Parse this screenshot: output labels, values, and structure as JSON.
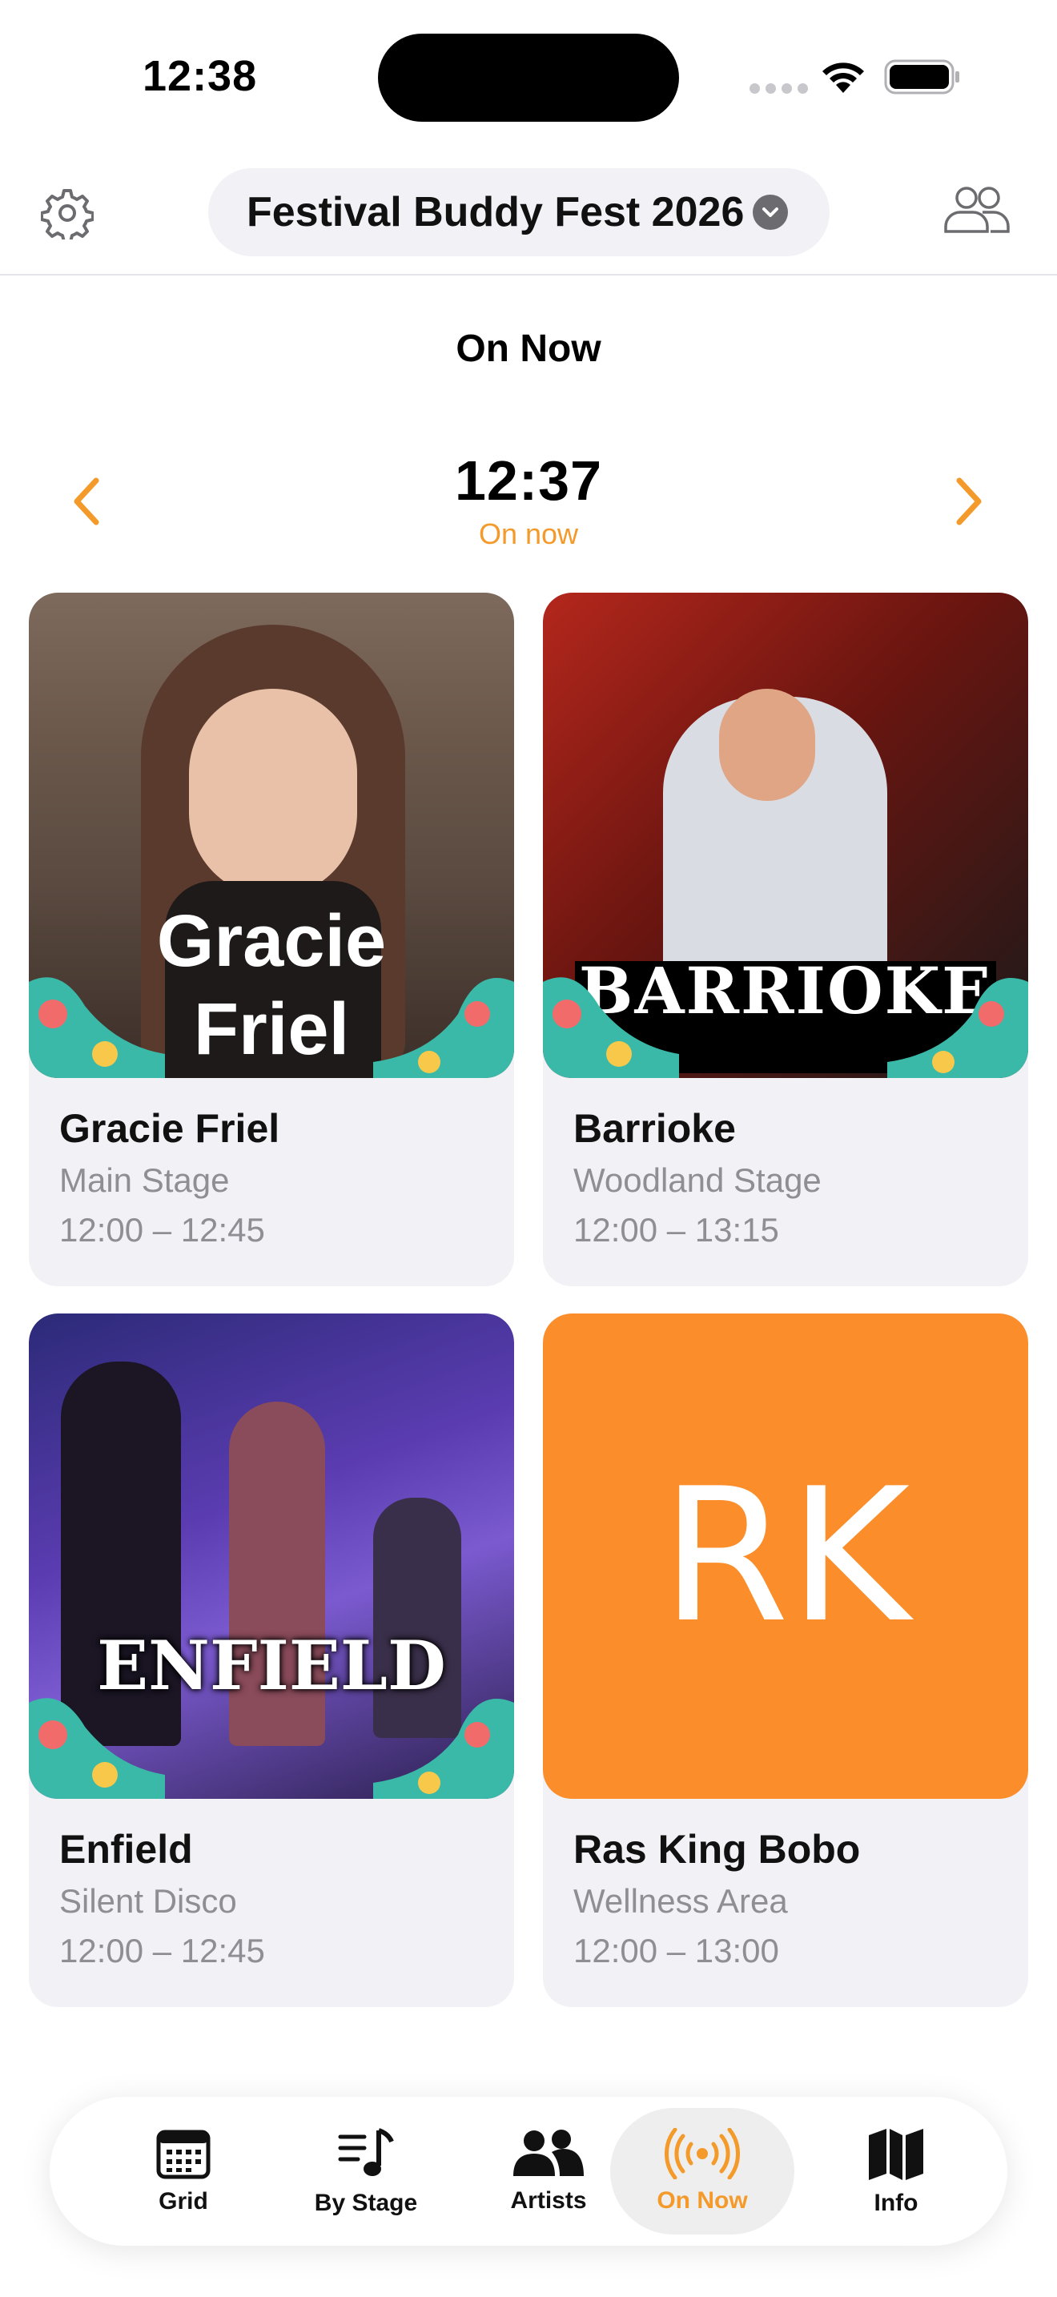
{
  "status_bar": {
    "time": "12:38"
  },
  "header": {
    "festival_name": "Festival Buddy Fest 2026",
    "settings_icon": "gear-icon",
    "friends_icon": "people-icon"
  },
  "page": {
    "title": "On Now"
  },
  "time_nav": {
    "time": "12:37",
    "subtitle": "On now"
  },
  "cards": [
    {
      "name": "Gracie Friel",
      "stage": "Main Stage",
      "time": "12:00 – 12:45",
      "image_text": [
        "Gracie",
        "Friel"
      ]
    },
    {
      "name": "Barrioke",
      "stage": "Woodland Stage",
      "time": "12:00 – 13:15",
      "image_text": [
        "BARRIOKE"
      ]
    },
    {
      "name": "Enfield",
      "stage": "Silent Disco",
      "time": "12:00 – 12:45",
      "image_text": [
        "ENFIELD"
      ]
    },
    {
      "name": "Ras King Bobo",
      "stage": "Wellness Area",
      "time": "12:00 – 13:00",
      "initials": "RK"
    }
  ],
  "tabs": [
    {
      "label": "Grid",
      "icon": "calendar-icon"
    },
    {
      "label": "By Stage",
      "icon": "music-list-icon"
    },
    {
      "label": "Artists",
      "icon": "people-icon"
    },
    {
      "label": "On Now",
      "icon": "broadcast-icon",
      "active": true
    },
    {
      "label": "Info",
      "icon": "map-icon"
    }
  ],
  "colors": {
    "accent": "#f39a2b",
    "card_bg": "#f1f1f6",
    "placeholder_bg": "#fb8d2b"
  }
}
